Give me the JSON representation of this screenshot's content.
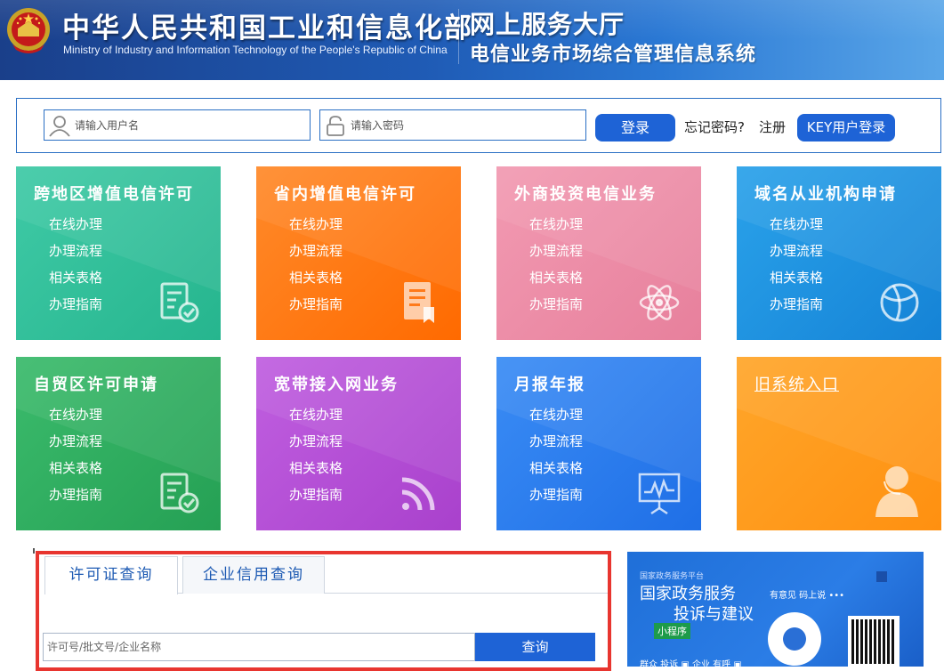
{
  "header": {
    "title_cn": "中华人民共和国工业和信息化部",
    "title_en": "Ministry of Industry and Information Technology of the People's Republic of China",
    "hall": "网上服务大厅",
    "system": "电信业务市场综合管理信息系统"
  },
  "login": {
    "username_placeholder": "请输入用户名",
    "password_placeholder": "请输入密码",
    "login_button": "登录",
    "forgot": "忘记密码?",
    "register": "注册",
    "key_login": "KEY用户登录"
  },
  "tiles": [
    {
      "title": "跨地区增值电信许可",
      "items": [
        "在线办理",
        "办理流程",
        "相关表格",
        "办理指南"
      ],
      "color": "#2fbf9a",
      "icon": "form-check-icon"
    },
    {
      "title": "省内增值电信许可",
      "items": [
        "在线办理",
        "办理流程",
        "相关表格",
        "办理指南"
      ],
      "color": "#ff7a1a",
      "icon": "document-bookmark-icon"
    },
    {
      "title": "外商投资电信业务",
      "items": [
        "在线办理",
        "办理流程",
        "相关表格",
        "办理指南"
      ],
      "color": "#ec8aa4",
      "icon": "atom-icon"
    },
    {
      "title": "域名从业机构申请",
      "items": [
        "在线办理",
        "办理流程",
        "相关表格",
        "办理指南"
      ],
      "color": "#1e8fe0",
      "icon": "globe-icon"
    },
    {
      "title": "自贸区许可申请",
      "items": [
        "在线办理",
        "办理流程",
        "相关表格",
        "办理指南"
      ],
      "color": "#2fae5e",
      "icon": "form-check-icon"
    },
    {
      "title": "宽带接入网业务",
      "items": [
        "在线办理",
        "办理流程",
        "相关表格",
        "办理指南"
      ],
      "color": "#b44ed6",
      "icon": "rss-icon"
    },
    {
      "title": "月报年报",
      "items": [
        "在线办理",
        "办理流程",
        "相关表格",
        "办理指南"
      ],
      "color": "#2e7ff0",
      "icon": "presentation-chart-icon"
    },
    {
      "title": "旧系统入口",
      "items": [],
      "color": "#ff9a1a",
      "icon": "person-headset-icon"
    }
  ],
  "query": {
    "tabs": [
      "许可证查询",
      "企业信用查询"
    ],
    "active_tab": 0,
    "input_placeholder": "许可号/批文号/企业名称",
    "button": "查询"
  },
  "banner": {
    "tag": "国家政务服务平台",
    "line1": "国家政务服务",
    "line2": "投诉与建议",
    "mini": "小程序",
    "side": "有意见 码上说 •••",
    "bottom": "群众 投诉 ▣  企业 有呼 ▣"
  },
  "colors": {
    "header_blue": "#1f5bb5",
    "button_blue": "#1e63d6",
    "query_border": "#e8352f"
  }
}
